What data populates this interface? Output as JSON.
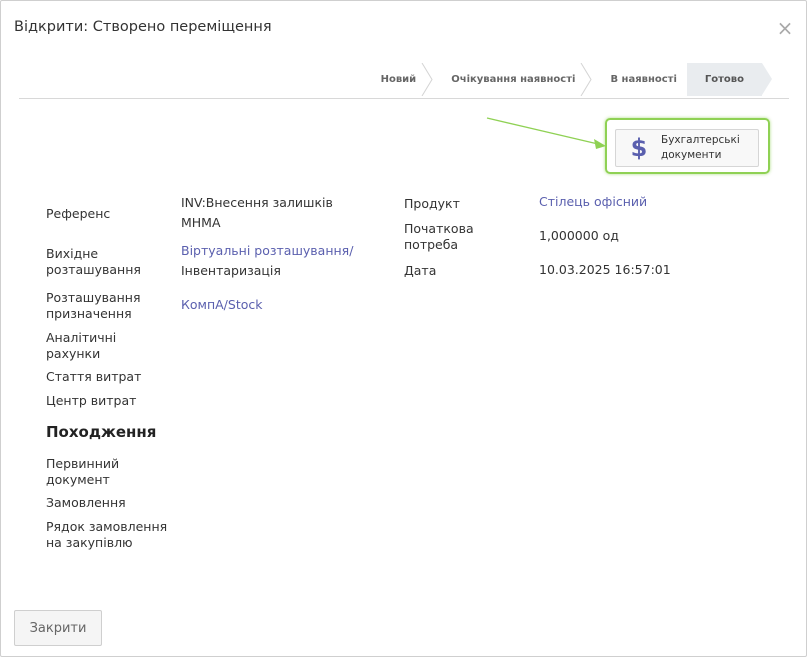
{
  "modal": {
    "title": "Відкрити: Створено переміщення",
    "close_symbol": "×"
  },
  "statusbar": {
    "stages": [
      {
        "label": "Новий",
        "active": false
      },
      {
        "label": "Очікування наявності",
        "active": false
      },
      {
        "label": "В наявності",
        "active": false
      },
      {
        "label": "Готово",
        "active": true
      }
    ]
  },
  "smart_button": {
    "icon": "dollar-icon",
    "line1": "Бухгалтерські",
    "line2": "документи"
  },
  "left_fields": {
    "reference": {
      "label": "Референс",
      "value_line1": "INV:Внесення залишків",
      "value_line2": "МНМА"
    },
    "source_location": {
      "label_line1": "Вихідне",
      "label_line2": "розташування",
      "value_link": "Віртуальні розташування/",
      "value_line2": "Інвентаризація"
    },
    "destination_location": {
      "label_line1": "Розташування",
      "label_line2": "призначення",
      "value_link": "КомпA/Stock"
    },
    "analytic_accounts": {
      "label_line1": "Аналітичні",
      "label_line2": "рахунки"
    },
    "expense_item": {
      "label": "Стаття витрат"
    },
    "cost_center": {
      "label": "Центр витрат"
    }
  },
  "right_fields": {
    "product": {
      "label": "Продукт",
      "value": "Стілець офісний"
    },
    "initial_demand": {
      "label_line1": "Початкова",
      "label_line2": "потреба",
      "value": "1,000000 од"
    },
    "date": {
      "label": "Дата",
      "value": "10.03.2025 16:57:01"
    }
  },
  "origin": {
    "title": "Походження",
    "source_document": {
      "label_line1": "Первинний",
      "label_line2": "документ"
    },
    "order": {
      "label": "Замовлення"
    },
    "purchase_order_line": {
      "label_line1": "Рядок замовлення",
      "label_line2": "на закупівлю"
    }
  },
  "footer": {
    "close_label": "Закрити"
  },
  "colors": {
    "link": "#5a5fae",
    "highlight": "#8fd154",
    "active_stage": "#e9ecef"
  }
}
